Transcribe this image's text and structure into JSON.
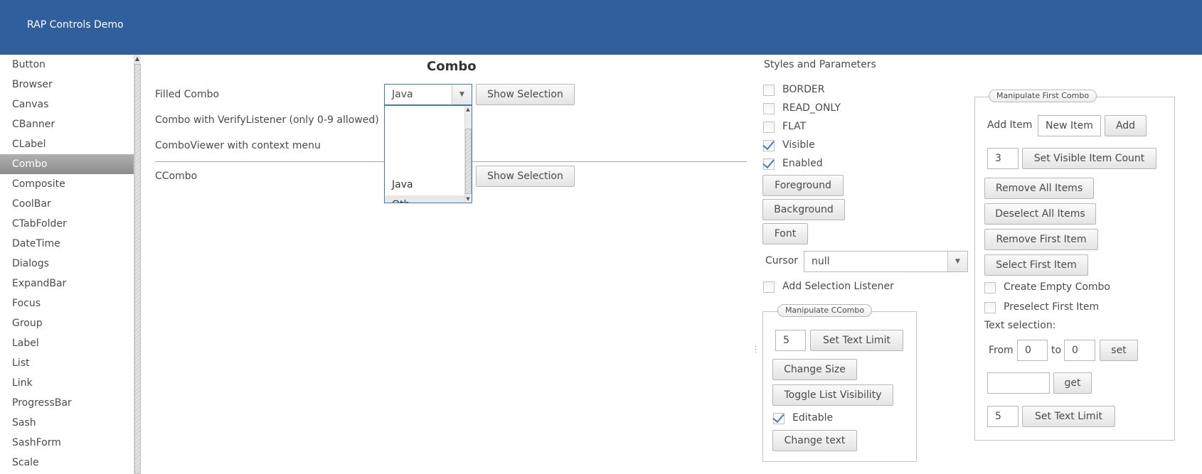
{
  "app": {
    "title": "RAP Controls Demo"
  },
  "nav": {
    "items": [
      "Button",
      "Browser",
      "Canvas",
      "CBanner",
      "CLabel",
      "Combo",
      "Composite",
      "CoolBar",
      "CTabFolder",
      "DateTime",
      "Dialogs",
      "ExpandBar",
      "Focus",
      "Group",
      "Label",
      "List",
      "Link",
      "ProgressBar",
      "Sash",
      "SashForm",
      "Scale"
    ],
    "selected": "Combo"
  },
  "demo": {
    "title": "Combo",
    "filled_label": "Filled Combo",
    "filled_value": "Java",
    "show_selection": "Show Selection",
    "verify_label": "Combo with VerifyListener (only 0-9 allowed)",
    "viewer_label": "ComboViewer with context menu",
    "ccombo_label": "CCombo",
    "dropdown_item_java": "Java",
    "dropdown_item_partial": "Oth"
  },
  "styles": {
    "title": "Styles and Parameters",
    "checks": [
      {
        "label": "BORDER",
        "checked": false
      },
      {
        "label": "READ_ONLY",
        "checked": false
      },
      {
        "label": "FLAT",
        "checked": false
      },
      {
        "label": "Visible",
        "checked": true
      },
      {
        "label": "Enabled",
        "checked": true
      }
    ],
    "foreground": "Foreground",
    "background": "Background",
    "font": "Font",
    "cursor_label": "Cursor",
    "cursor_value": "null",
    "add_selection_listener": "Add Selection Listener"
  },
  "ccombo_group": {
    "title": "Manipulate CCombo",
    "text_limit_value": "5",
    "set_text_limit": "Set Text Limit",
    "change_size": "Change Size",
    "toggle_list": "Toggle List Visibility",
    "editable": "Editable",
    "change_text": "Change text"
  },
  "first_group": {
    "title": "Manipulate First Combo",
    "add_item_label": "Add Item",
    "new_item_value": "New Item",
    "add": "Add",
    "visible_count_value": "3",
    "set_visible_count": "Set Visible Item Count",
    "remove_all": "Remove All Items",
    "deselect_all": "Deselect All Items",
    "remove_first": "Remove First Item",
    "select_first": "Select First Item",
    "create_empty": "Create Empty Combo",
    "preselect_first": "Preselect First Item",
    "text_selection": "Text selection:",
    "from": "From",
    "from_value": "0",
    "to": "to",
    "to_value": "0",
    "set": "set",
    "get_value": "",
    "get": "get",
    "text_limit_value": "5",
    "set_text_limit": "Set Text Limit"
  },
  "colors": {
    "header": "#2f5f9d",
    "check": "#4a78b5",
    "nav_selected": "#9a9a9a"
  },
  "icons": {
    "combo_arrow": "triangle-down-icon",
    "check": "checkmark-icon",
    "sash_handle": "vertical-dots-icon"
  }
}
